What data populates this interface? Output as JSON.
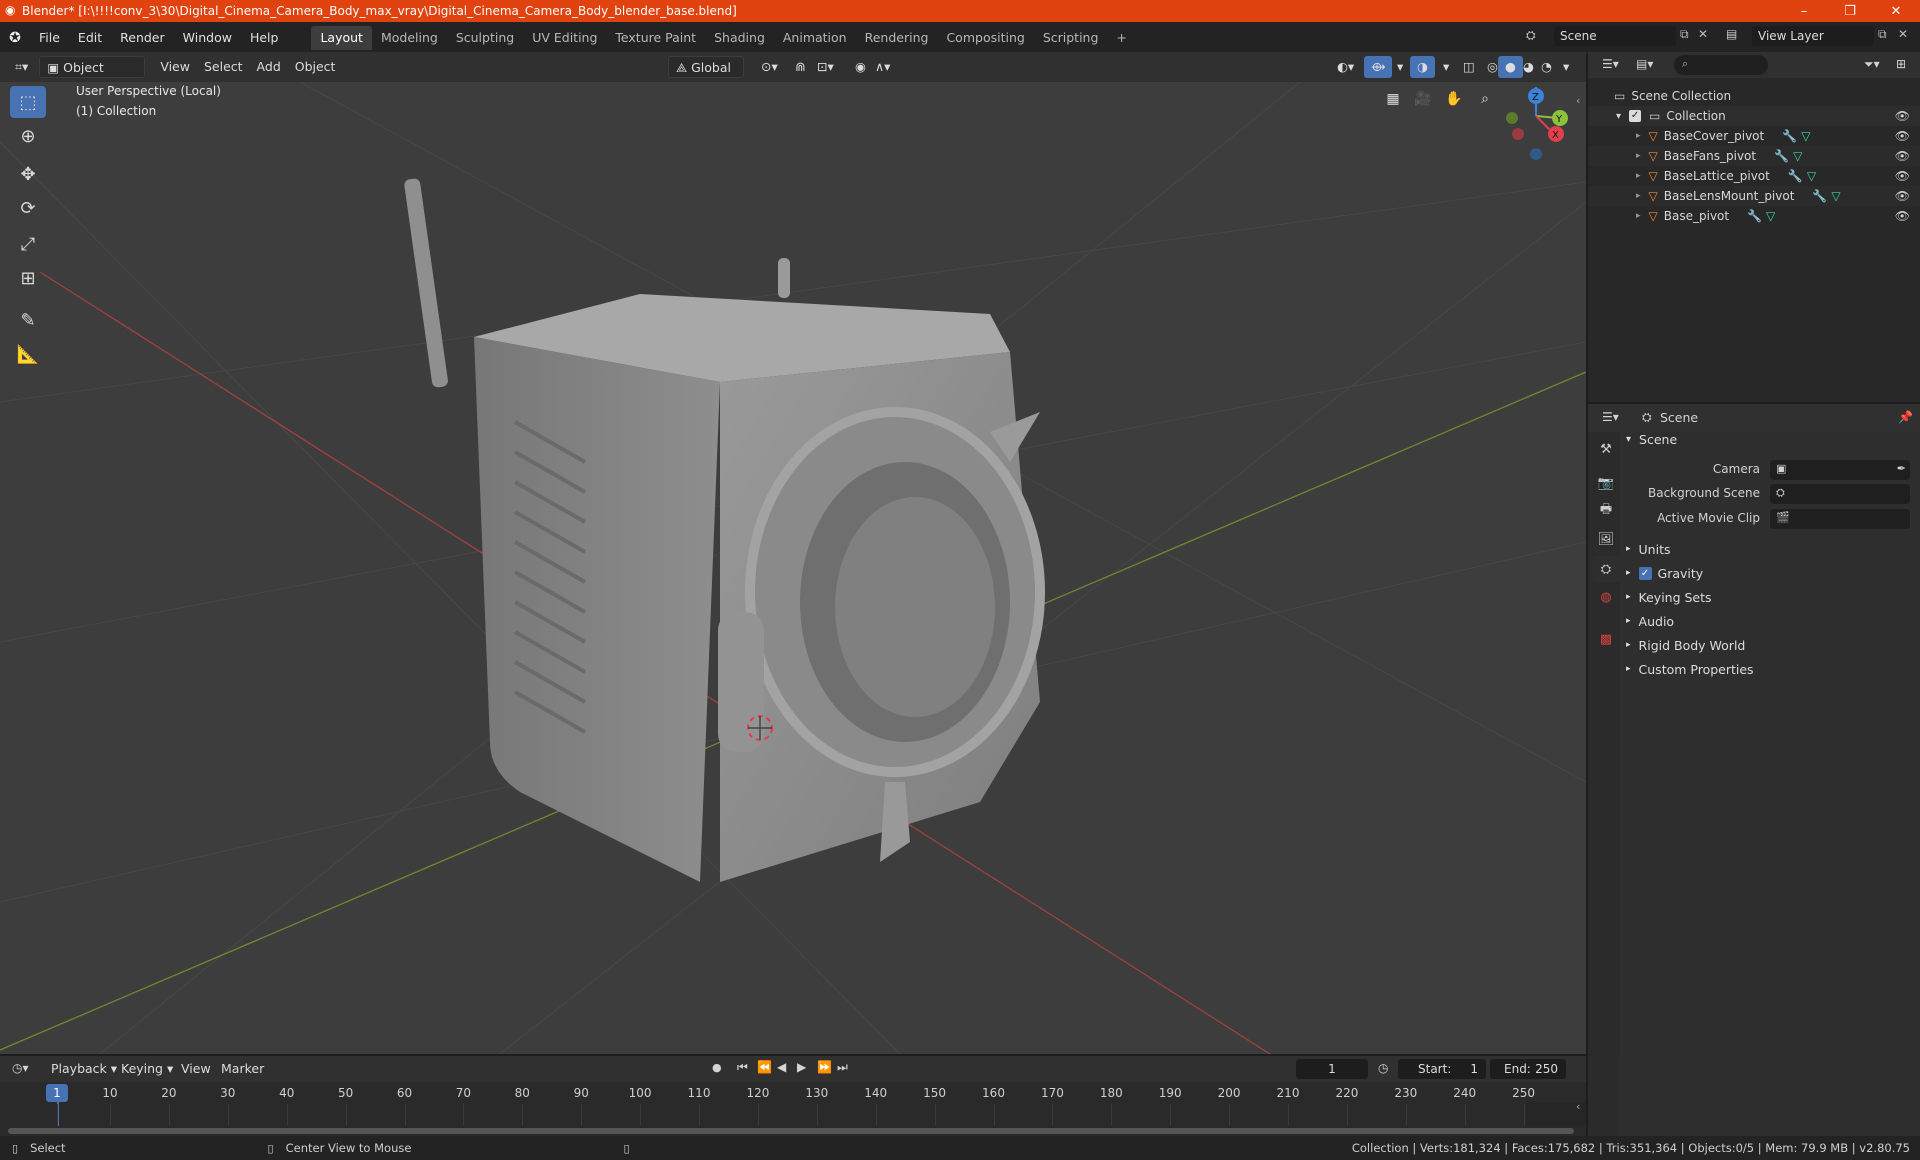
{
  "window": {
    "title": "Blender* [I:\\!!!!conv_3\\30\\Digital_Cinema_Camera_Body_max_vray\\Digital_Cinema_Camera_Body_blender_base.blend]",
    "controls": [
      "–",
      "❐",
      "✕"
    ]
  },
  "menu": [
    "File",
    "Edit",
    "Render",
    "Window",
    "Help"
  ],
  "workspaces": [
    "Layout",
    "Modeling",
    "Sculpting",
    "UV Editing",
    "Texture Paint",
    "Shading",
    "Animation",
    "Rendering",
    "Compositing",
    "Scripting"
  ],
  "add_workspace": "+",
  "scene_selector": "Scene",
  "view_layer_selector": "View Layer",
  "viewport_header": {
    "mode": "Object Mode",
    "menus": [
      "View",
      "Select",
      "Add",
      "Object"
    ],
    "transform_orientation": "Global"
  },
  "viewport": {
    "perspective_label": "User Perspective (Local)",
    "collection_label": "(1) Collection",
    "gizmo_axes": [
      "X",
      "Y",
      "Z"
    ]
  },
  "outliner": {
    "scene_collection": "Scene Collection",
    "collection": "Collection",
    "objects": [
      "BaseCover_pivot",
      "BaseFans_pivot",
      "BaseLattice_pivot",
      "BaseLensMount_pivot",
      "Base_pivot"
    ]
  },
  "properties": {
    "header": "Scene",
    "panel": "Scene",
    "fields": [
      {
        "label": "Camera"
      },
      {
        "label": "Background Scene"
      },
      {
        "label": "Active Movie Clip"
      }
    ],
    "sections": [
      "Units",
      "Gravity",
      "Keying Sets",
      "Audio",
      "Rigid Body World",
      "Custom Properties"
    ],
    "gravity_checked": true
  },
  "timeline": {
    "menus": [
      "Playback",
      "Keying",
      "View",
      "Marker"
    ],
    "current_frame": "1",
    "start_label": "Start:",
    "start": "1",
    "end_label": "End:",
    "end": "250",
    "ticks": [
      "1",
      "10",
      "20",
      "30",
      "40",
      "50",
      "60",
      "70",
      "80",
      "90",
      "100",
      "110",
      "120",
      "130",
      "140",
      "150",
      "160",
      "170",
      "180",
      "190",
      "200",
      "210",
      "220",
      "230",
      "240",
      "250"
    ]
  },
  "statusbar": {
    "select": "Select",
    "center_view": "Center View to Mouse",
    "stats": "Collection | Verts:181,324 | Faces:175,682 | Tris:351,364 | Objects:0/5 | Mem: 79.9 MB | v2.80.75"
  },
  "colors": {
    "titlebar": "#e0430f",
    "accent": "#4772b3",
    "x_axis": "#e0404e",
    "y_axis": "#8bc23a",
    "z_axis": "#3b82d8"
  }
}
